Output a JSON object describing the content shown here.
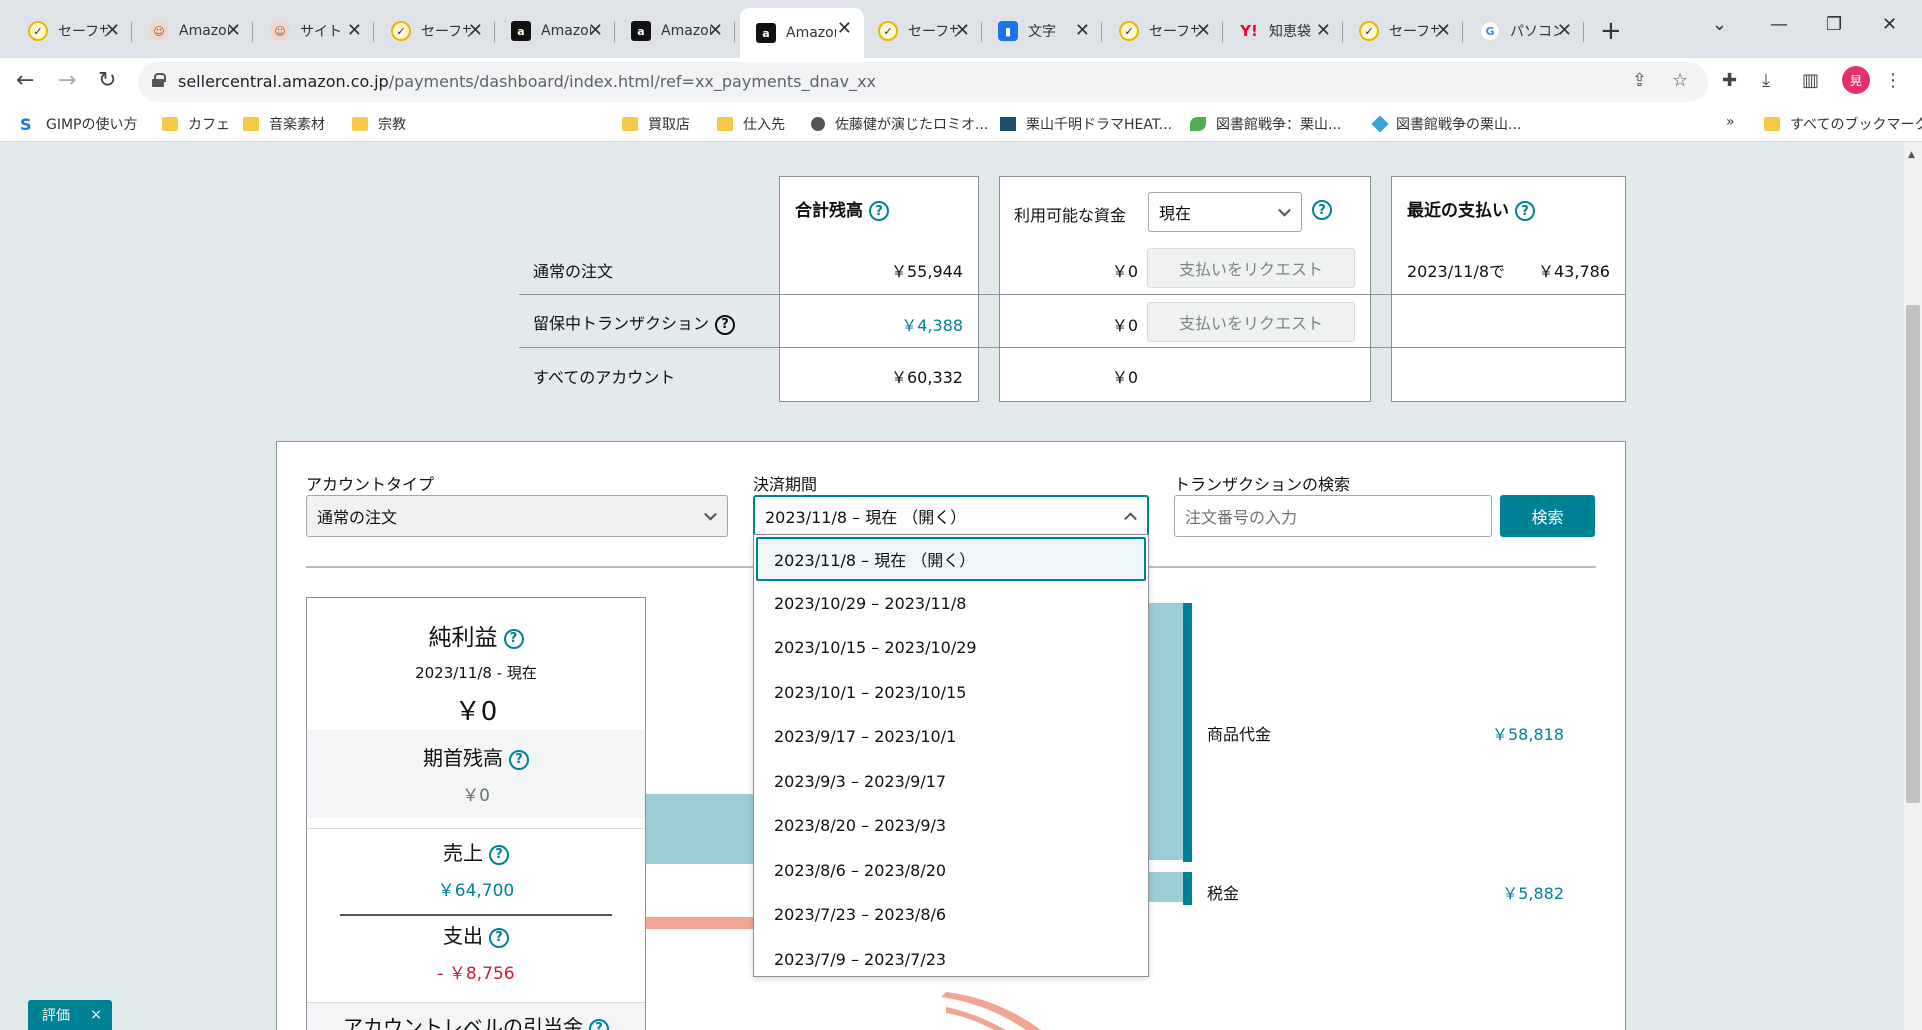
{
  "browser": {
    "tabs": [
      {
        "title": "セーフサー",
        "favicon": "check"
      },
      {
        "title": "Amazon",
        "favicon": "face"
      },
      {
        "title": "サイト",
        "favicon": "face"
      },
      {
        "title": "セーフサー",
        "favicon": "check"
      },
      {
        "title": "Amazon",
        "favicon": "amz"
      },
      {
        "title": "Amazon",
        "favicon": "amz"
      },
      {
        "title": "Amazon",
        "favicon": "amz",
        "active": true
      },
      {
        "title": "セーフサー",
        "favicon": "check"
      },
      {
        "title": "文字",
        "favicon": "blue"
      },
      {
        "title": "セーフサー",
        "favicon": "check"
      },
      {
        "title": "知恵袋",
        "favicon": "yahoo"
      },
      {
        "title": "セーフサー",
        "favicon": "check"
      },
      {
        "title": "パソコン",
        "favicon": "google"
      }
    ],
    "url_host": "sellercentral.amazon.co.jp",
    "url_path": "/payments/dashboard/index.html/ref=xx_payments_dnav_xx",
    "profile_initial": "晃",
    "bookmarks": [
      {
        "label": "GIMPの使い方",
        "icon": "gimp"
      },
      {
        "label": "カフェ",
        "icon": "folder"
      },
      {
        "label": "音楽素材",
        "icon": "folder"
      },
      {
        "label": "宗教",
        "icon": "folder"
      },
      {
        "label": "買取店",
        "icon": "folder"
      },
      {
        "label": "仕入先",
        "icon": "folder"
      },
      {
        "label": "佐藤健が演じたロミオ...",
        "icon": "globe"
      },
      {
        "label": "栗山千明ドラマHEAT...",
        "icon": "sq"
      },
      {
        "label": "図書館戦争：栗山...",
        "icon": "leaf"
      },
      {
        "label": "図書館戦争の栗山...",
        "icon": "diamond"
      }
    ],
    "bookmarks_more": "»",
    "all_bookmarks": "すべてのブックマーク"
  },
  "balances": {
    "total_header": "合計残高",
    "available_label": "利用可能な資金",
    "available_select": "現在",
    "recent_header": "最近の支払い",
    "rows": [
      {
        "label": "通常の注文",
        "total": "￥55,944",
        "available": "￥0",
        "button": "支払いをリクエスト"
      },
      {
        "label": "留保中トランザクション",
        "total": "￥4,388",
        "available": "￥0",
        "button": "支払いをリクエスト"
      },
      {
        "label": "すべてのアカウント",
        "total": "￥60,332",
        "available": "￥0"
      }
    ],
    "recent_date": "2023/11/8で",
    "recent_amount": "￥43,786"
  },
  "filters": {
    "account_type_label": "アカウントタイプ",
    "account_type_value": "通常の注文",
    "period_label": "決済期間",
    "period_value": "2023/11/8 – 現在 （開く）",
    "search_label": "トランザクションの検索",
    "search_placeholder": "注文番号の入力",
    "search_button": "検索"
  },
  "period_options": [
    "2023/11/8 – 現在 （開く）",
    "2023/10/29 – 2023/11/8",
    "2023/10/15 – 2023/10/29",
    "2023/10/1 – 2023/10/15",
    "2023/9/17 – 2023/10/1",
    "2023/9/3 – 2023/9/17",
    "2023/8/20 – 2023/9/3",
    "2023/8/6 – 2023/8/20",
    "2023/7/23 – 2023/8/6",
    "2023/7/9 – 2023/7/23"
  ],
  "summary": {
    "net_title": "純利益",
    "net_period": "2023/11/8 - 現在",
    "net_value": "￥0",
    "opening_title": "期首残高",
    "opening_value": "￥0",
    "sales_title": "売上",
    "sales_value": "￥64,700",
    "expense_title": "支出",
    "expense_value": "- ￥8,756",
    "account_level_title": "アカウントレベルの引当金"
  },
  "breakdown": [
    {
      "label": "商品代金",
      "value": "￥58,818"
    },
    {
      "label": "税金",
      "value": "￥5,882"
    }
  ],
  "colors": {
    "teal": "#008296",
    "light_teal": "#9ccdd7",
    "salmon": "#f2a593",
    "red": "#cc1c39"
  },
  "feedback": {
    "label": "評価",
    "close": "×"
  }
}
